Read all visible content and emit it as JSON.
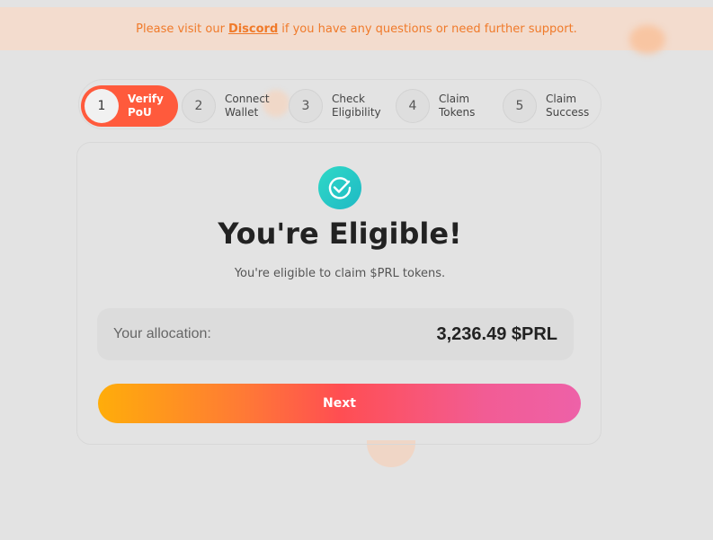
{
  "banner": {
    "prefix": "Please visit our",
    "link": "Discord",
    "suffix": "if you have any questions or need further support."
  },
  "steps": [
    {
      "number": "1",
      "line1": "Verify",
      "line2": "PoU",
      "active": true
    },
    {
      "number": "2",
      "line1": "Connect",
      "line2": "Wallet",
      "active": false
    },
    {
      "number": "3",
      "line1": "Check",
      "line2": "Eligibility",
      "active": false
    },
    {
      "number": "4",
      "line1": "Claim",
      "line2": "Tokens",
      "active": false
    },
    {
      "number": "5",
      "line1": "Claim",
      "line2": "Success",
      "active": false
    }
  ],
  "card": {
    "icon": "check-circle-icon",
    "title": "You're Eligible!",
    "subtitle": "You're eligible to claim $PRL tokens.",
    "allocation_label": "Your allocation:",
    "allocation_value": "3,236.49 $PRL",
    "next_label": "Next"
  },
  "colors": {
    "accent": "#ff5a3c",
    "banner_text": "#f07a2a",
    "check": "#2fd9c6"
  }
}
